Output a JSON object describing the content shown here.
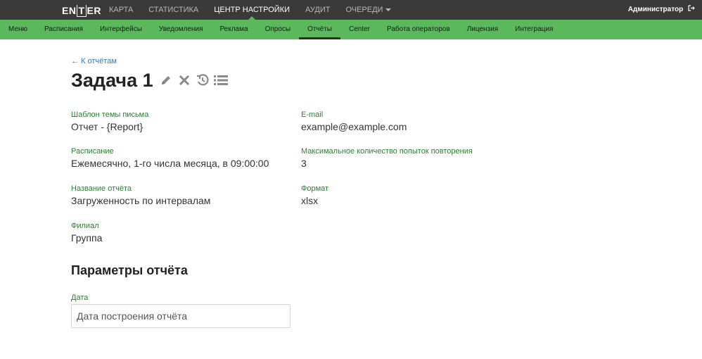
{
  "topbar": {
    "logo": {
      "left": "EN",
      "mid": "T",
      "right": "ER"
    },
    "nav": [
      "КАРТА",
      "СТАТИСТИКА",
      "ЦЕНТР НАСТРОЙКИ",
      "АУДИТ",
      "ОЧЕРЕДИ"
    ],
    "active": "ЦЕНТР НАСТРОЙКИ",
    "user": "Администратор"
  },
  "subnav": {
    "items": [
      "Меню",
      "Расписания",
      "Интерфейсы",
      "Уведомления",
      "Реклама",
      "Опросы",
      "Отчёты",
      "Center",
      "Работа операторов",
      "Лицензия",
      "Интеграция"
    ],
    "active": "Отчёты"
  },
  "page": {
    "back": "← К отчётам",
    "title": "Задача 1"
  },
  "fields": {
    "subject": {
      "label": "Шаблон темы письма",
      "value": "Отчет - {Report}"
    },
    "email": {
      "label": "E-mail",
      "value": "example@example.com"
    },
    "schedule": {
      "label": "Расписание",
      "value": "Ежемесячно, 1-го числа месяца, в 09:00:00"
    },
    "retries": {
      "label": "Максимальное количество попыток повторения",
      "value": "3"
    },
    "report_name": {
      "label": "Название отчёта",
      "value": "Загруженность по интервалам"
    },
    "format": {
      "label": "Формат",
      "value": "xlsx"
    },
    "branch": {
      "label": "Филиал",
      "value": "Группа"
    }
  },
  "params": {
    "title": "Параметры отчёта",
    "date_label": "Дата",
    "date_placeholder": "Дата построения отчёта"
  },
  "colors": {
    "topbar": "#3a3a3a",
    "accent": "#5cb85c",
    "label": "#2e7d32",
    "link": "#337ab7"
  },
  "icons": [
    "pencil-icon",
    "close-icon",
    "history-icon",
    "list-icon",
    "logout-icon",
    "chevron-down-icon"
  ]
}
